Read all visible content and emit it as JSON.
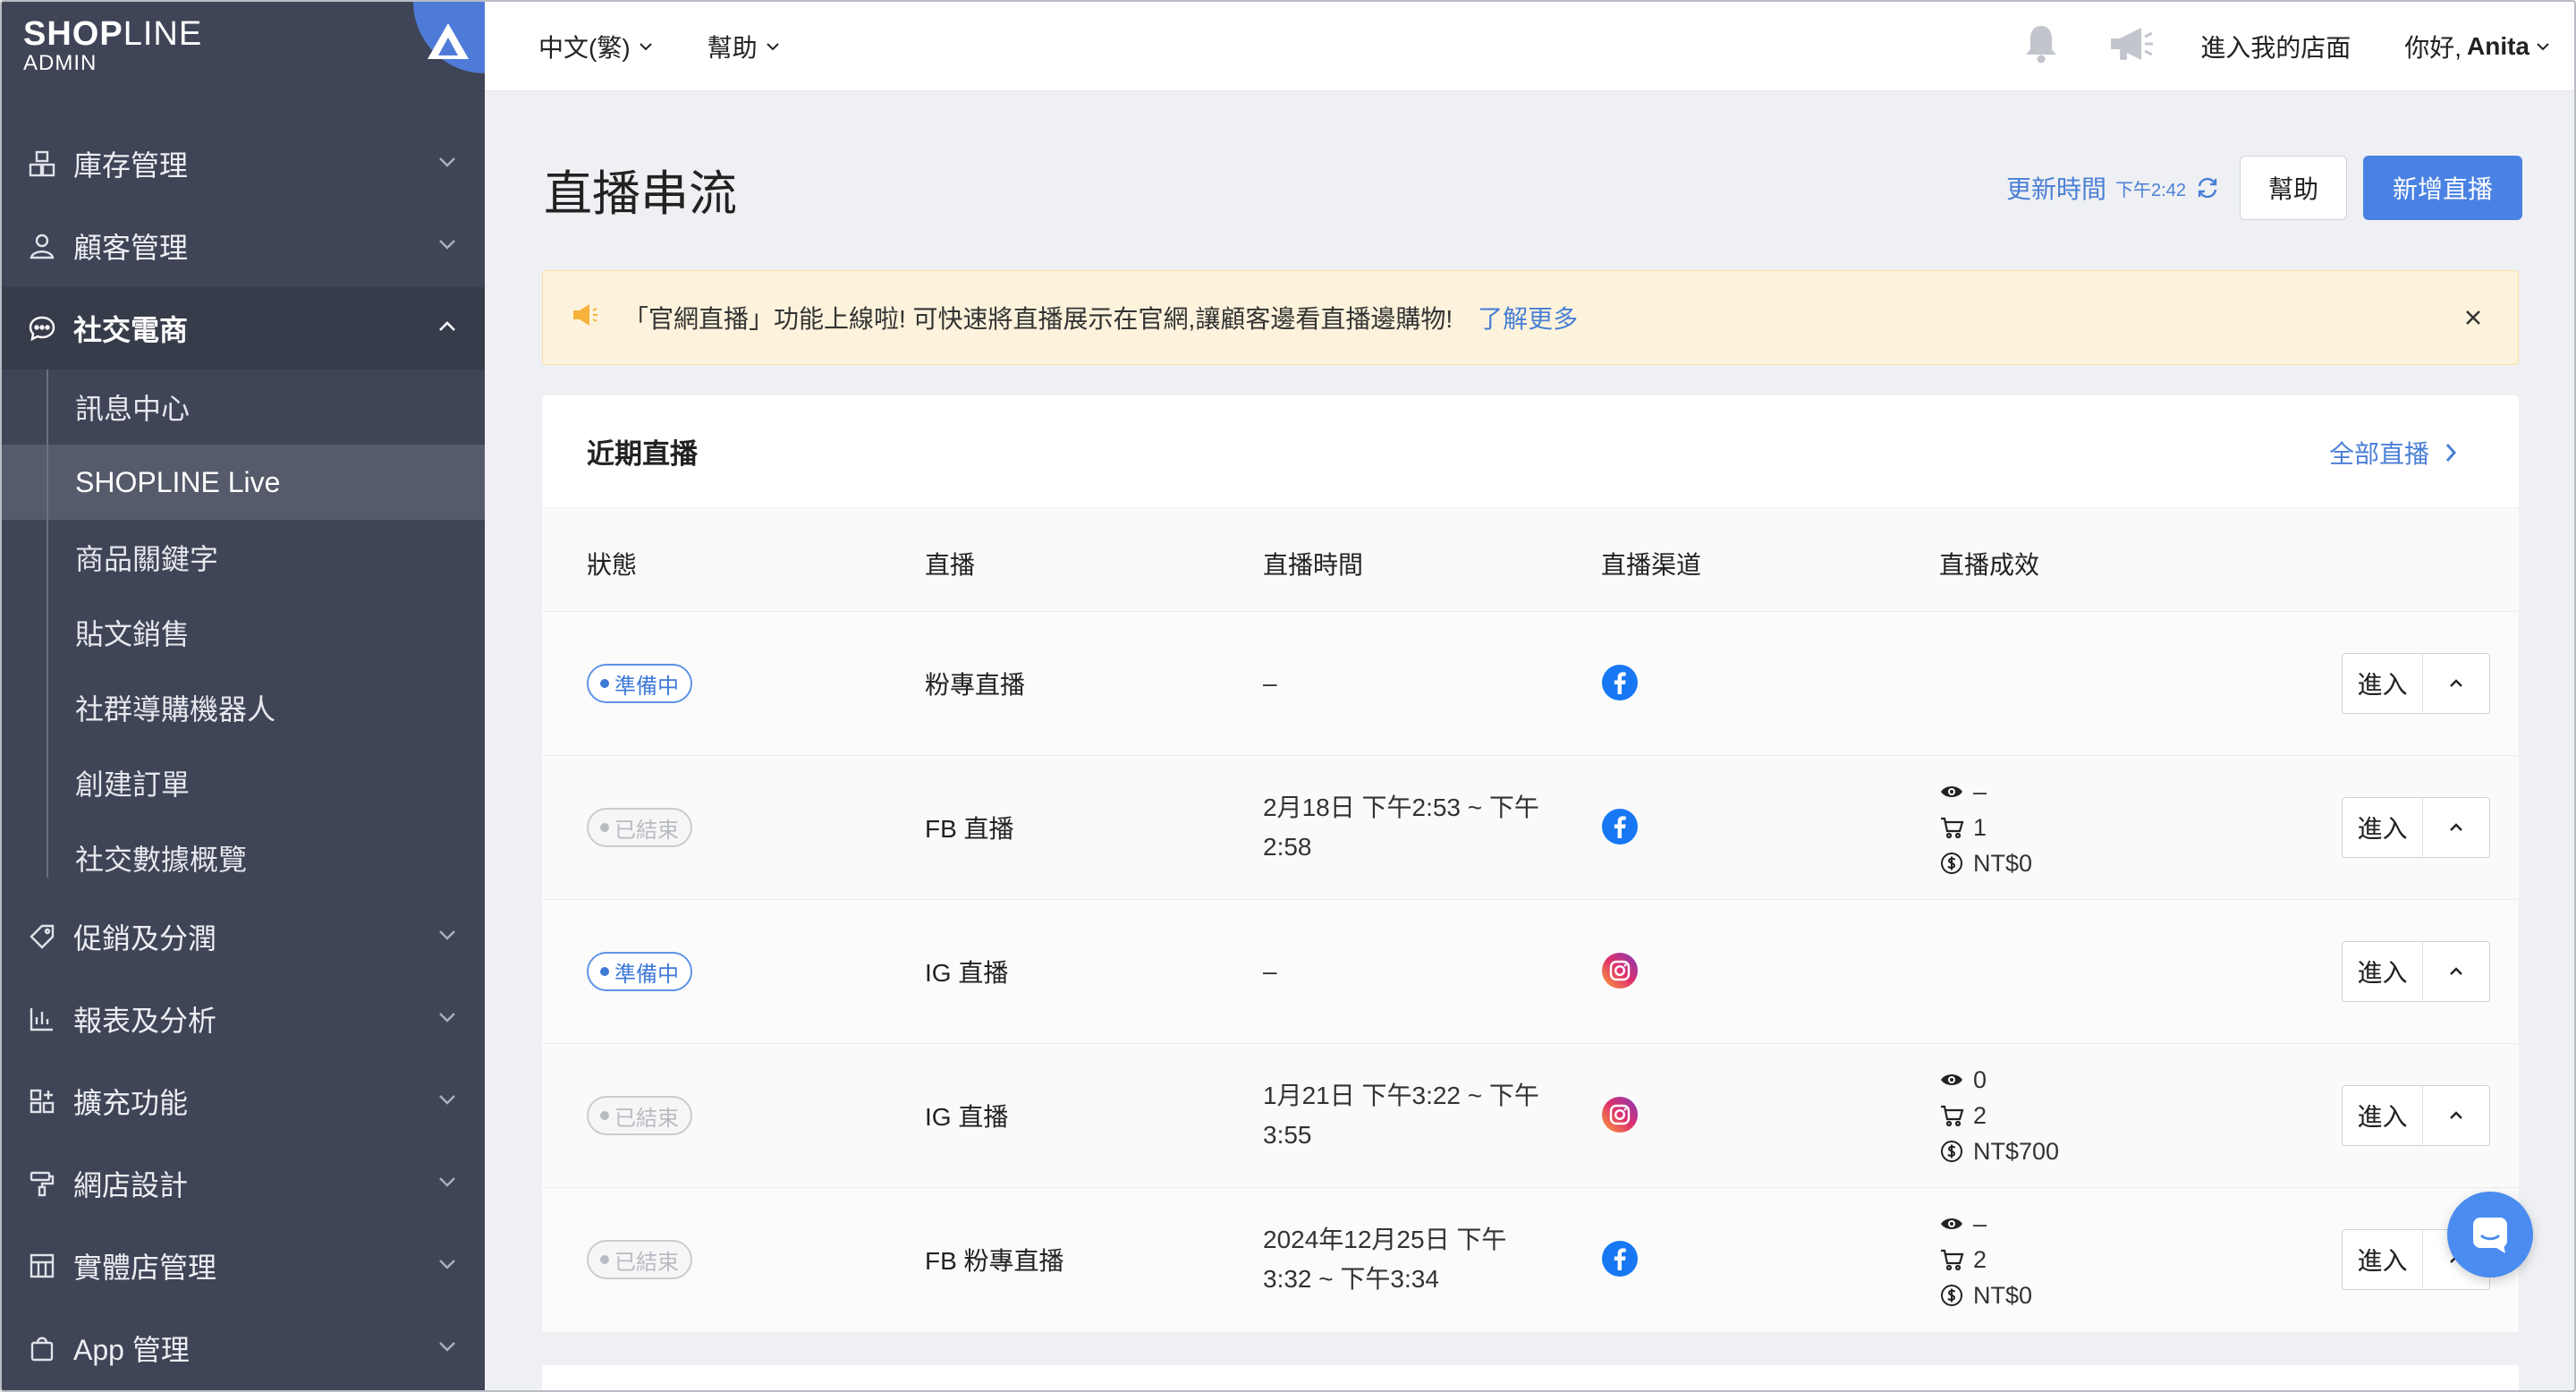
{
  "brand": {
    "logo_main": "SHOP",
    "logo_main2": "LINE",
    "logo_sub": "ADMIN"
  },
  "sidebar": {
    "items": [
      {
        "label": "庫存管理",
        "icon": "inventory-icon"
      },
      {
        "label": "顧客管理",
        "icon": "customer-icon"
      },
      {
        "label": "社交電商",
        "icon": "chat-icon"
      },
      {
        "label": "促銷及分潤",
        "icon": "tag-icon"
      },
      {
        "label": "報表及分析",
        "icon": "chart-icon"
      },
      {
        "label": "擴充功能",
        "icon": "apps-icon"
      },
      {
        "label": "網店設計",
        "icon": "brush-icon"
      },
      {
        "label": "實體店管理",
        "icon": "store-icon"
      },
      {
        "label": "App 管理",
        "icon": "bag-icon"
      }
    ],
    "sub_items": [
      "訊息中心",
      "SHOPLINE Live",
      "商品關鍵字",
      "貼文銷售",
      "社群導購機器人",
      "創建訂單",
      "社交數據概覽"
    ]
  },
  "topbar": {
    "language": "中文(繁)",
    "help": "幫助",
    "store_link": "進入我的店面",
    "greeting": "你好,",
    "user": "Anita"
  },
  "page": {
    "title": "直播串流",
    "update_label": "更新時間",
    "update_time": "下午2:42",
    "help_button": "幫助",
    "new_button": "新增直播"
  },
  "notice": {
    "text": "「官網直播」功能上線啦!  可快速將直播展示在官網,讓顧客邊看直播邊購物!",
    "link": "了解更多"
  },
  "recent": {
    "title": "近期直播",
    "all_link": "全部直播",
    "columns": [
      "狀態",
      "直播",
      "直播時間",
      "直播渠道",
      "直播成效"
    ],
    "rows": [
      {
        "status": "準備中",
        "name": "粉專直播",
        "time1": "–",
        "time2": "",
        "channel": "facebook",
        "views": "",
        "carts": "",
        "sales": "",
        "enter": "進入"
      },
      {
        "status": "已結束",
        "name": "FB 直播",
        "time1": "2月18日 下午2:53 ~ 下午",
        "time2": "2:58",
        "channel": "facebook",
        "views": "–",
        "carts": "1",
        "sales": "NT$0",
        "enter": "進入"
      },
      {
        "status": "準備中",
        "name": "IG 直播",
        "time1": "–",
        "time2": "",
        "channel": "instagram",
        "views": "",
        "carts": "",
        "sales": "",
        "enter": "進入"
      },
      {
        "status": "已結束",
        "name": "IG 直播",
        "time1": "1月21日 下午3:22 ~ 下午",
        "time2": "3:55",
        "channel": "instagram",
        "views": "0",
        "carts": "2",
        "sales": "NT$700",
        "enter": "進入"
      },
      {
        "status": "已結束",
        "name": "FB 粉專直播",
        "time1": "2024年12月25日 下午",
        "time2": "3:32 ~ 下午3:34",
        "channel": "facebook",
        "views": "–",
        "carts": "2",
        "sales": "NT$0",
        "enter": "進入"
      }
    ]
  },
  "colors": {
    "sidebar": "#3f4556",
    "accent": "#4a82e3",
    "notice_bg": "#fdf3dc",
    "facebook": "#1877f2",
    "arrow": "#e0513c"
  }
}
